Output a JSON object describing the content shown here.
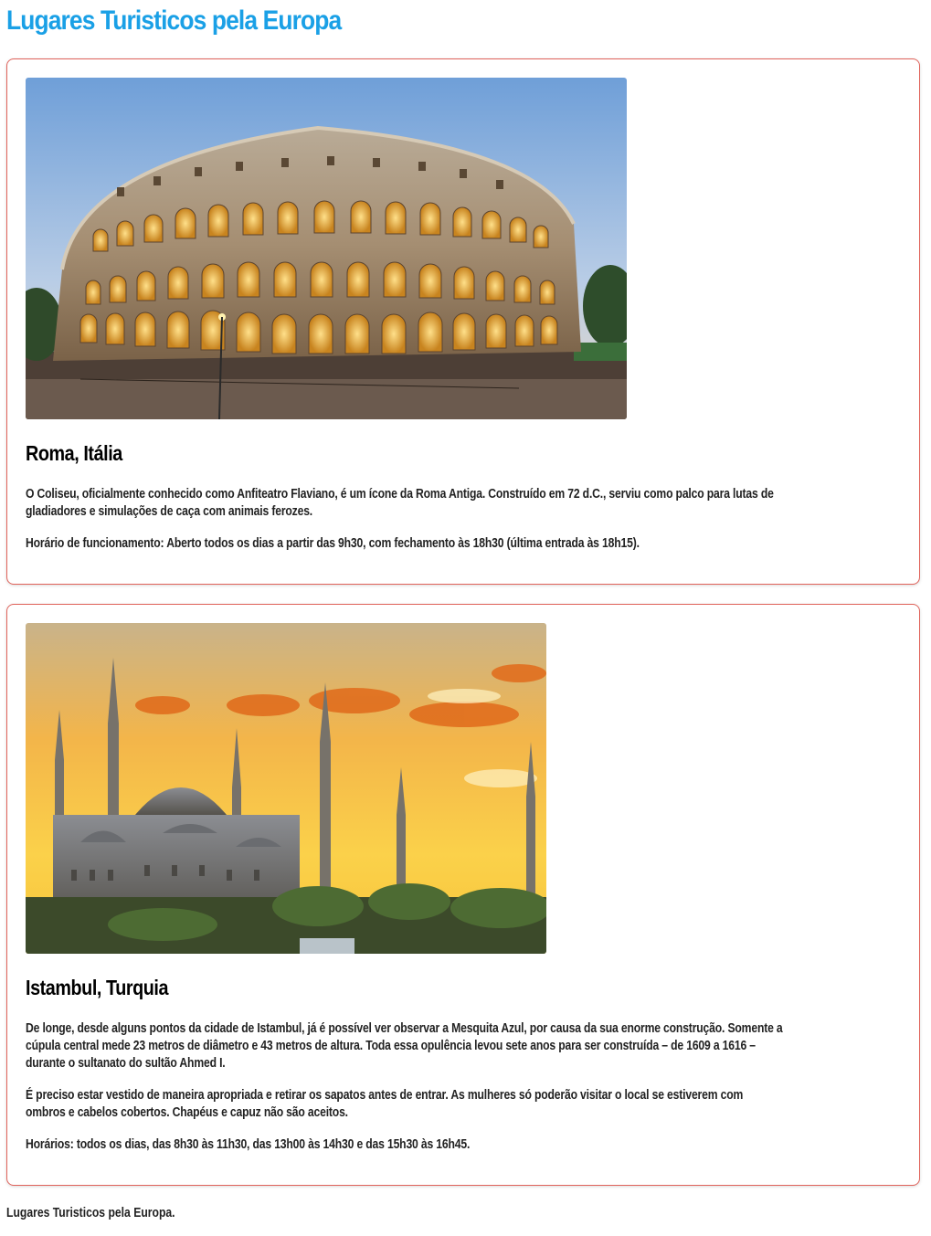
{
  "page": {
    "title": "Lugares Turisticos pela Europa"
  },
  "places": [
    {
      "name": "Roma, Itália",
      "image_alt": "Coliseu",
      "paragraphs": [
        "O Coliseu, oficialmente conhecido como Anfiteatro Flaviano, é um ícone da Roma Antiga. Construído em 72 d.C., serviu como palco para lutas de",
        "gladiadores e simulações de caça com animais ferozes.",
        "Horário de funcionamento: Aberto todos os dias a partir das 9h30, com fechamento às 18h30 (última entrada às 18h15)."
      ]
    },
    {
      "name": "Istambul, Turquia",
      "image_alt": "Mesquita Azul",
      "paragraphs": [
        "De longe, desde alguns pontos da cidade de Istambul, já é possível ver observar a Mesquita Azul, por causa da sua enorme construção. Somente a",
        "cúpula central mede 23 metros de diâmetro e 43 metros de altura. Toda essa opulência levou sete anos para ser construída – de 1609 a 1616 –",
        "durante o sultanato do sultão Ahmed I.",
        "É preciso estar vestido de maneira apropriada e retirar os sapatos antes de entrar. As mulheres só poderão visitar o local se estiverem com",
        "ombros e cabelos cobertos. Chapéus e capuz não são aceitos.",
        "Horários: todos os dias, das 8h30 às 11h30, das 13h00 às 14h30 e das 15h30 às 16h45."
      ]
    }
  ],
  "footer": {
    "text": "Lugares Turisticos pela Europa."
  }
}
